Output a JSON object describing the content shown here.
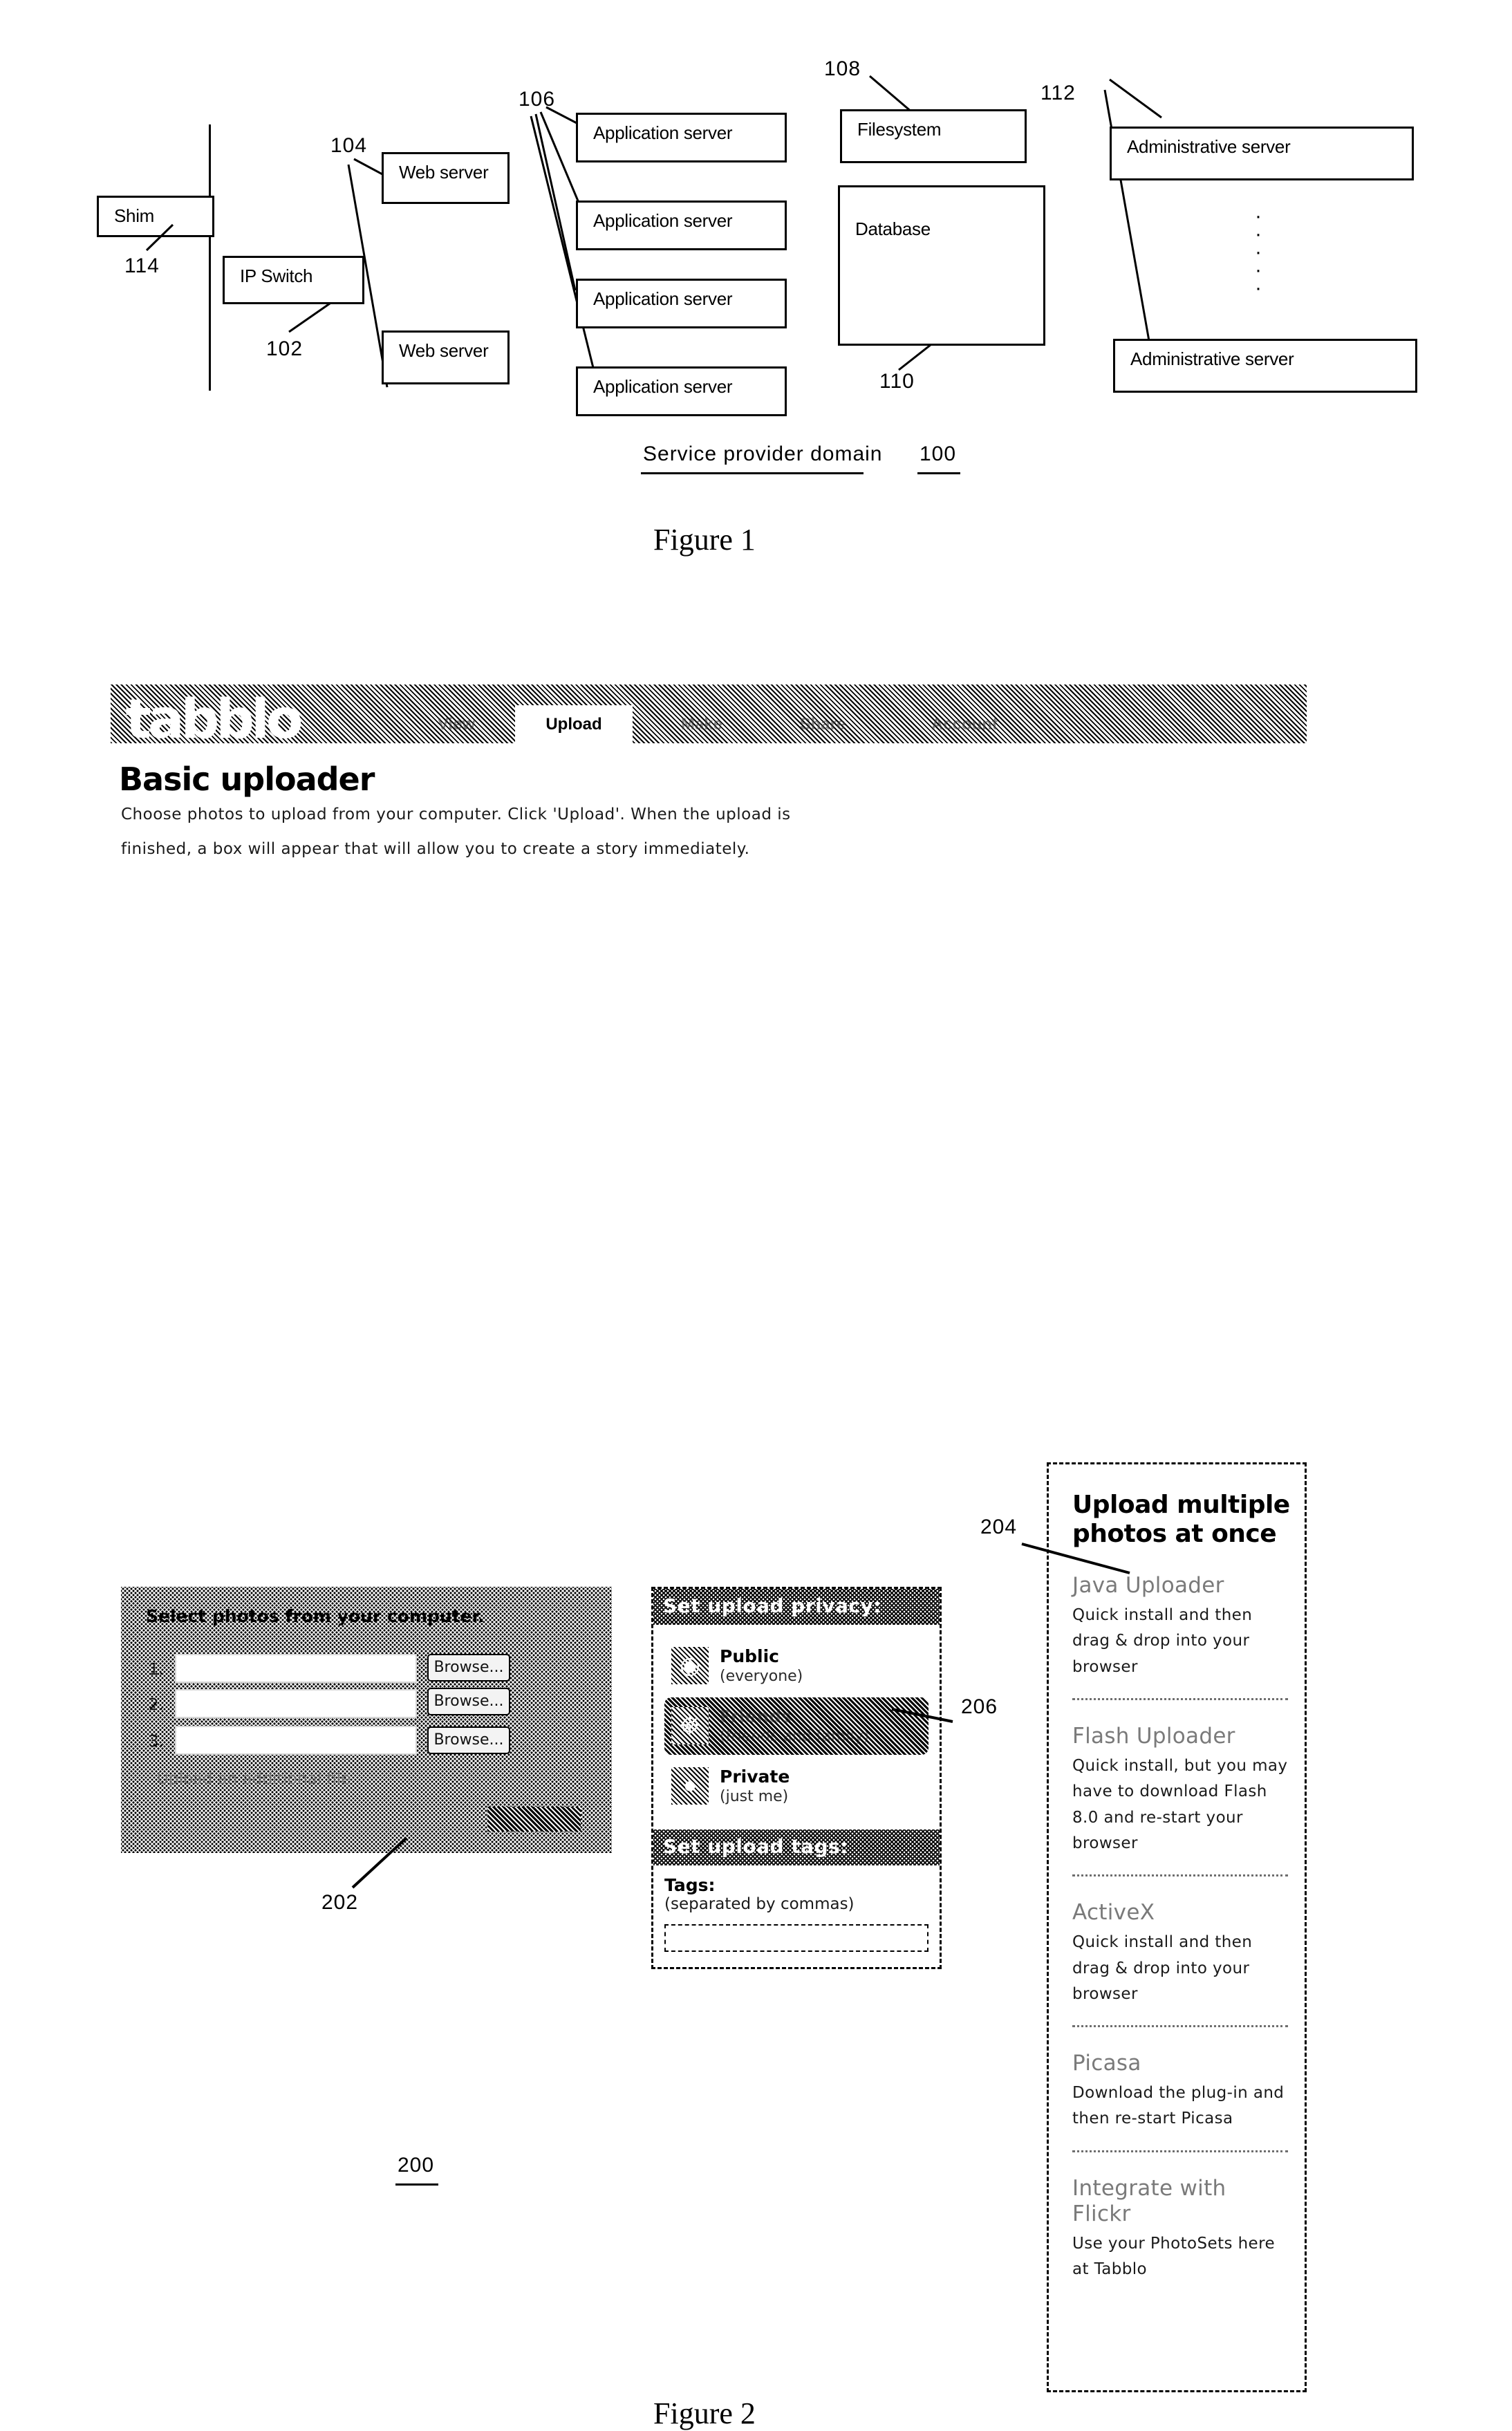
{
  "figure1": {
    "caption": "Figure 1",
    "boxes": {
      "shim": "Shim",
      "ip_switch": "IP Switch",
      "web_server_1": "Web server",
      "web_server_2": "Web server",
      "app_server_1": "Application server",
      "app_server_2": "Application server",
      "app_server_3": "Application server",
      "app_server_4": "Application server",
      "filesystem": "Filesystem",
      "database": "Database",
      "admin_server_1": "Administrative server",
      "admin_server_2": "Administrative server"
    },
    "domain_label": "Service provider domain",
    "reference_numerals": {
      "shim": "114",
      "ip_switch": "102",
      "web_server": "104",
      "app_server": "106",
      "filesystem": "108",
      "database": "110",
      "admin_server": "112",
      "domain": "100"
    },
    "vertical_ellipsis": "·"
  },
  "figure2": {
    "caption": "Figure 2",
    "header": {
      "logo": "tabblo",
      "tabs": [
        {
          "label": "View",
          "active": false
        },
        {
          "label": "Upload",
          "active": true
        },
        {
          "label": "Make",
          "active": false
        },
        {
          "label": "Share",
          "active": false
        },
        {
          "label": "Account",
          "active": false
        }
      ]
    },
    "page_title": "Basic uploader",
    "intro_line_1": "Choose photos to upload from your computer. Click 'Upload'. When the upload is",
    "intro_line_2": "finished, a box will appear that will allow you to create a story immediately.",
    "select_panel": {
      "title": "Select photos from your computer.",
      "rows": [
        {
          "num": "1.",
          "value": "",
          "browse_label": "Browse..."
        },
        {
          "num": "2.",
          "value": "",
          "browse_label": "Browse..."
        },
        {
          "num": "3.",
          "value": "",
          "browse_label": "Browse..."
        }
      ],
      "additional_link": "Upload an additional file",
      "upload_button": "Upload"
    },
    "privacy_panel": {
      "header": "Set upload privacy:",
      "options": [
        {
          "main": "Public",
          "sub": "(everyone)",
          "icon": "globe-icon",
          "selected": false
        },
        {
          "main": "Friends",
          "sub": "(friends and family)",
          "icon": "people-icon",
          "selected": true
        },
        {
          "main": "Private",
          "sub": "(just me)",
          "icon": "lock-icon",
          "selected": false
        }
      ]
    },
    "tags_panel": {
      "header": "Set upload tags:",
      "label": "Tags:",
      "sub_label": "(separated by commas)",
      "value": ""
    },
    "sidebar": {
      "heading": "Upload multiple photos at once",
      "items": [
        {
          "title": "Java Uploader",
          "desc": "Quick install and then drag & drop into your browser"
        },
        {
          "title": "Flash Uploader",
          "desc": "Quick install, but you may have to download Flash 8.0 and re-start your browser"
        },
        {
          "title": "ActiveX",
          "desc": "Quick install and then drag & drop into your browser"
        },
        {
          "title": "Picasa",
          "desc": "Download the plug-in and then re-start Picasa"
        },
        {
          "title": "Integrate with Flickr",
          "desc": "Use your PhotoSets here at Tabblo"
        }
      ]
    },
    "reference_numerals": {
      "screen": "200",
      "select_panel": "202",
      "sidebar": "204",
      "privacy_panel": "206"
    }
  }
}
